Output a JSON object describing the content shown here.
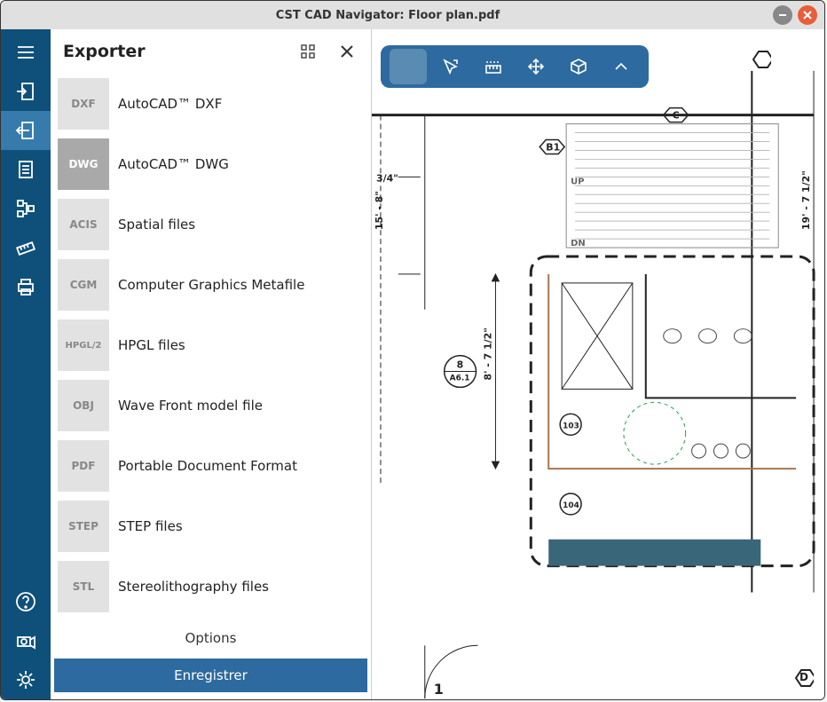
{
  "title": "CST CAD Navigator: Floor plan.pdf",
  "exporter": {
    "title": "Exporter",
    "formats": [
      {
        "badge": "DXF",
        "label": "AutoCAD™ DXF"
      },
      {
        "badge": "DWG",
        "label": "AutoCAD™ DWG"
      },
      {
        "badge": "ACIS",
        "label": "Spatial files"
      },
      {
        "badge": "CGM",
        "label": "Computer Graphics Metafile"
      },
      {
        "badge": "HPGL/2",
        "label": "HPGL files"
      },
      {
        "badge": "OBJ",
        "label": "Wave Front model file"
      },
      {
        "badge": "PDF",
        "label": "Portable Document Format"
      },
      {
        "badge": "STEP",
        "label": "STEP files"
      },
      {
        "badge": "STL",
        "label": "Stereolithography files"
      }
    ],
    "options": "Options",
    "save": "Enregistrer",
    "selected": 1
  },
  "plan": {
    "dim1": "3/4\"",
    "dim2": "15' - 8\"",
    "dim3": "8' - 7 1/2\"",
    "dim4": "19' - 7 1/2\"",
    "hexB1": "B1",
    "hexC": "C",
    "hexD": "D",
    "roomCircle": "8",
    "roomSub": "A6.1",
    "door103": "103",
    "door104": "104",
    "stairUp": "UP",
    "stairDn": "DN",
    "bottomLabel": "1"
  }
}
